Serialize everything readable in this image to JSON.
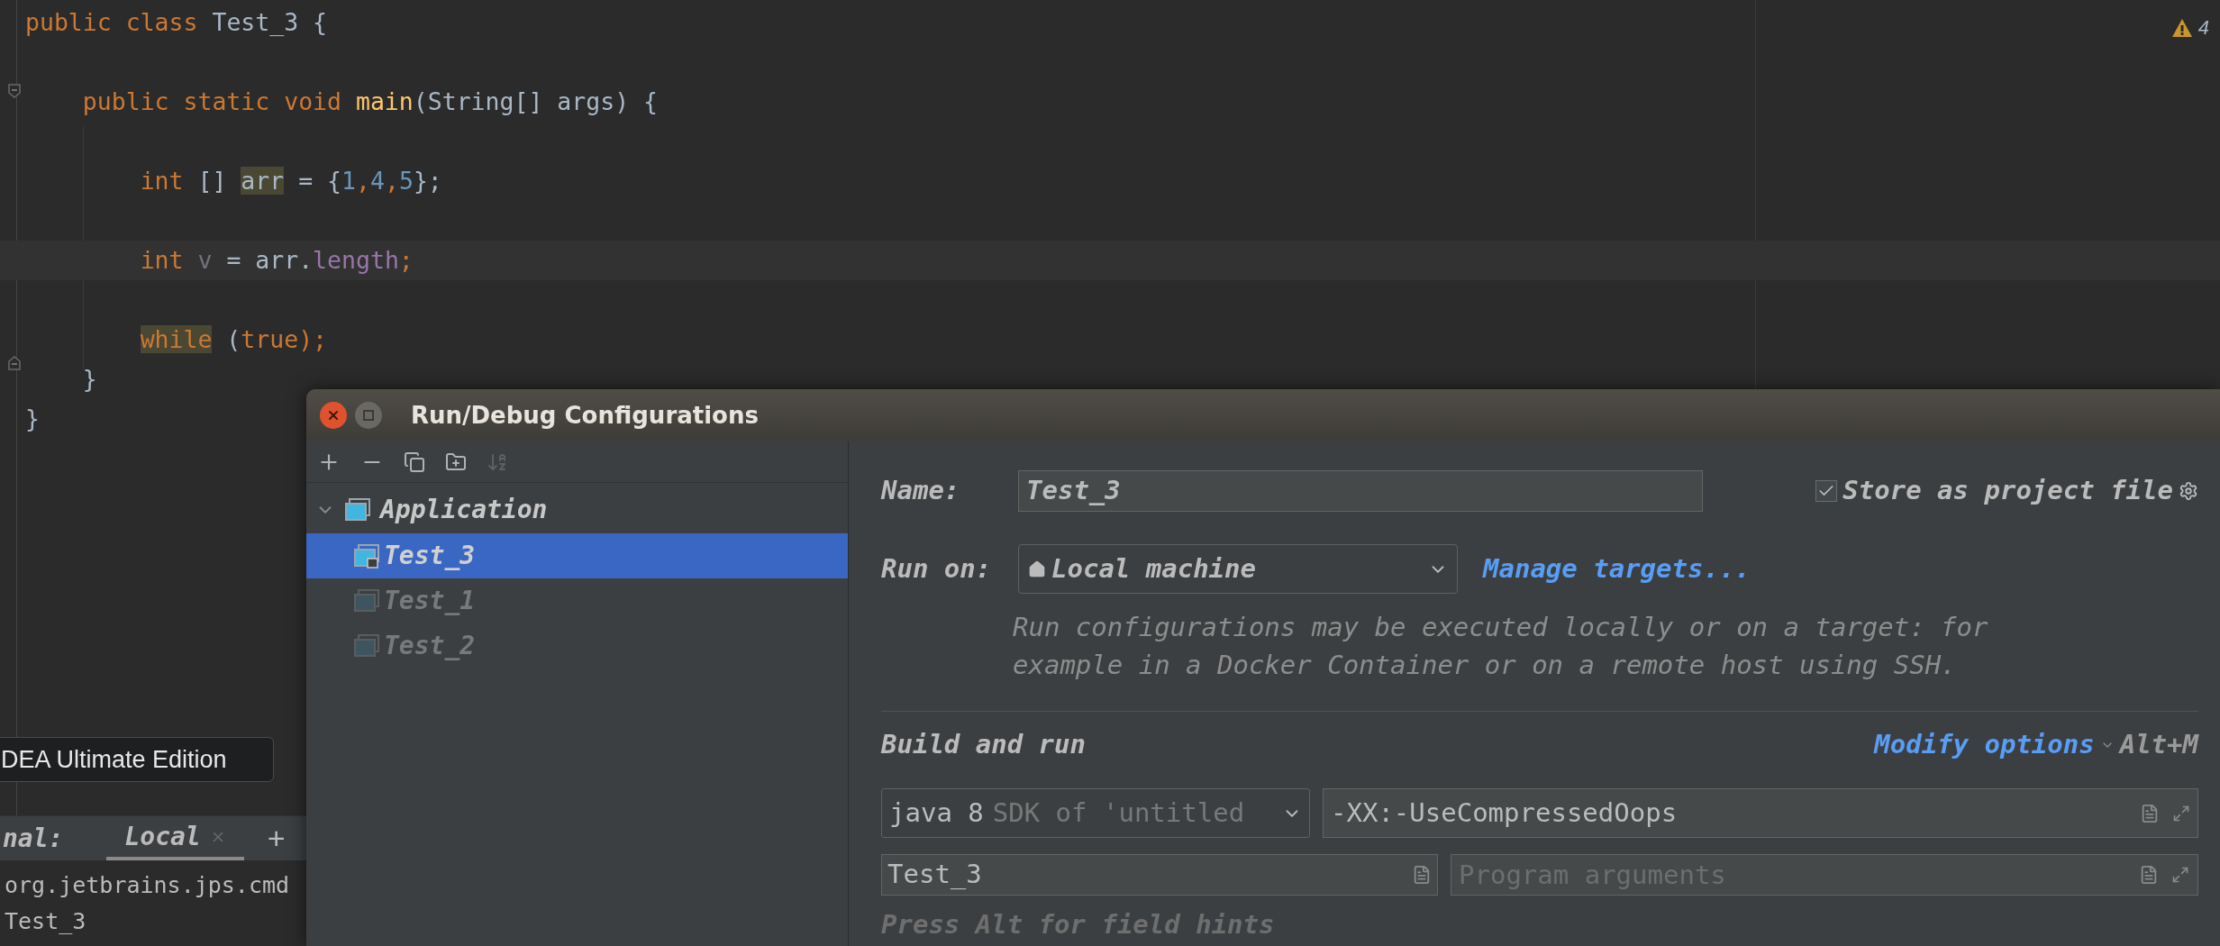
{
  "editor": {
    "warning_count": "4",
    "lines": [
      {
        "current": false,
        "tokens": [
          {
            "text": "public ",
            "kind": "keyword"
          },
          {
            "text": "class ",
            "kind": "keyword"
          },
          {
            "text": "Test_3 {",
            "kind": "plain"
          }
        ],
        "children": [
          {
            "current": false
          },
          {
            "current": false,
            "fold_start": true,
            "tokens": [
              {
                "text": "public static void ",
                "kind": "keyword"
              },
              {
                "text": "main",
                "kind": "method"
              },
              {
                "text": "(String[] args) {",
                "kind": "plain"
              }
            ],
            "children": [
              {
                "current": false
              },
              {
                "current": false,
                "tokens": [
                  {
                    "text": "int ",
                    "kind": "keyword"
                  },
                  {
                    "text": "[] ",
                    "kind": "plain"
                  },
                  {
                    "text": "arr",
                    "kind": "plain",
                    "highlighted": true
                  },
                  {
                    "text": " = {",
                    "kind": "plain"
                  },
                  {
                    "text": "1",
                    "kind": "number"
                  },
                  {
                    "text": ",",
                    "kind": "keyword"
                  },
                  {
                    "text": "4",
                    "kind": "number"
                  },
                  {
                    "text": ",",
                    "kind": "keyword"
                  },
                  {
                    "text": "5",
                    "kind": "number"
                  },
                  {
                    "text": "};",
                    "kind": "plain"
                  }
                ]
              },
              {
                "current": false
              },
              {
                "current": true,
                "tokens": [
                  {
                    "text": "int ",
                    "kind": "keyword"
                  },
                  {
                    "text": "v",
                    "kind": "unused"
                  },
                  {
                    "text": " = arr.",
                    "kind": "plain"
                  },
                  {
                    "text": "length",
                    "kind": "field"
                  },
                  {
                    "text": ";",
                    "kind": "keyword"
                  }
                ]
              },
              {
                "current": false
              },
              {
                "current": false,
                "tokens": [
                  {
                    "text": "while",
                    "kind": "keyword",
                    "highlighted": true
                  },
                  {
                    "text": " (",
                    "kind": "plain"
                  },
                  {
                    "text": "true",
                    "kind": "keyword"
                  },
                  {
                    "text": ");",
                    "kind": "keyword"
                  }
                ]
              }
            ]
          },
          {
            "current": false,
            "fold_end": true,
            "tokens": [
              {
                "text": "}",
                "kind": "plain"
              }
            ]
          }
        ]
      },
      {
        "current": false,
        "tokens": [
          {
            "text": "}",
            "kind": "plain"
          }
        ]
      }
    ]
  },
  "tooltip": "DEA Ultimate Edition",
  "terminal": {
    "label": "nal:",
    "tabs": [
      {
        "label": "Local",
        "selected": true
      }
    ],
    "new_tab": "+",
    "lines": [
      "org.jetbrains.jps.cmd",
      "Test_3"
    ]
  },
  "dialog": {
    "title": "Run/Debug Configurations",
    "tree": {
      "label": "Application",
      "expanded": true,
      "children": [
        {
          "label": "Test_3",
          "selected": true,
          "dimmed": false
        },
        {
          "label": "Test_1",
          "selected": false,
          "dimmed": true
        },
        {
          "label": "Test_2",
          "selected": false,
          "dimmed": true
        }
      ]
    },
    "name_label": "Name:",
    "name_value": "Test_3",
    "store": {
      "label": "Store as project file",
      "checked": true
    },
    "run_on_label": "Run on:",
    "run_on_value": "Local machine",
    "manage_link": "Manage targets...",
    "description": [
      "Run configurations may be executed locally or on a target: for",
      "example in a Docker Container or on a remote host using SSH."
    ],
    "section": "Build and run",
    "modify_link": "Modify options",
    "shortcut": "Alt+M",
    "jre": {
      "value": "java 8",
      "hint": "SDK of 'untitled"
    },
    "vm_options": "-XX:-UseCompressedOops",
    "main_class": "Test_3",
    "program_args_placeholder": "Program arguments",
    "footer": "Press Alt for field hints"
  }
}
